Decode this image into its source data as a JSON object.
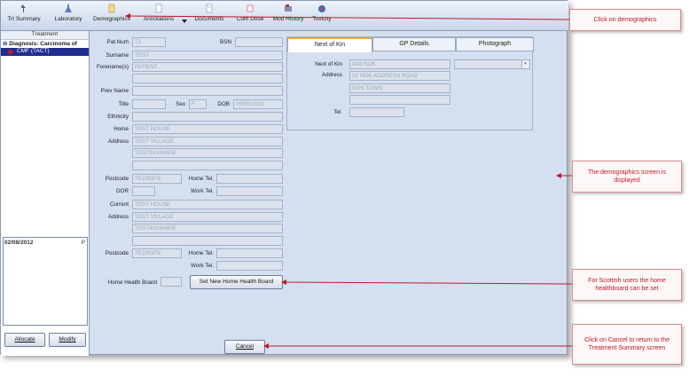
{
  "toolbar": {
    "items": [
      {
        "label": "Trt Summary",
        "icon": "treatment-summary-icon"
      },
      {
        "label": "Laboratory",
        "icon": "flask-icon"
      },
      {
        "label": "Demographics",
        "icon": "person-card-icon"
      },
      {
        "label": "Annotations",
        "icon": "note-icon"
      },
      {
        "label": "Documents",
        "icon": "document-icon"
      },
      {
        "label": "Cum Dose",
        "icon": "chart-icon"
      },
      {
        "label": "Mod History",
        "icon": "history-icon"
      },
      {
        "label": "Toxicity",
        "icon": "toxicity-icon"
      }
    ]
  },
  "left_panel": {
    "header": "Treatment",
    "diagnosis": "Diagnosis: Carcinoma of",
    "regimen": "CMF (TACT)",
    "date": "02/08/2012",
    "date_suffix": "P",
    "allocate_label": "Allocate",
    "modify_label": "Modify"
  },
  "form": {
    "patnum_label": "Pat.Num",
    "patnum": "T1",
    "bsn_label": "BSN",
    "surname_label": "Surname",
    "surname": "TEST",
    "forenames_label": "Forename(s)",
    "forenames": "PATIENT",
    "prevname_label": "Prev Name",
    "title_label": "Title",
    "sex_label": "Sex",
    "sex": "F",
    "dob_label": "DOB",
    "dob": "09/09/1933",
    "ethnicity_label": "Ethnicity",
    "home_label": "Home",
    "address_label": "Address",
    "home_addr1": "TEST HOUSE",
    "home_addr2": "TEST VILLAGE",
    "home_addr3": "TESTINGSHIRE",
    "postcode_label": "Postcode",
    "home_postcode": "TE238976",
    "home_tel_label": "Home Tel.",
    "dor_label": "DOR",
    "work_tel_label": "Work Tel.",
    "current_label": "Current",
    "cur_addr1": "TEST HOUSE",
    "cur_addr2": "TEST VILLAGE",
    "cur_addr3": "TESTINGSHIRE",
    "cur_postcode": "TE230976",
    "hhb_label": "Home Health Board",
    "set_hhb_label": "Set New Home Health Board",
    "cancel_label": "Cancel"
  },
  "kin": {
    "tabs": [
      "Next of Kin",
      "GP Details",
      "Photograph"
    ],
    "nok_label": "Next of Kin",
    "nok_name": "IAM NOK",
    "address_label": "Address",
    "addr1": "22 NOK ADDRESS ROAD",
    "addr2": "NOK TOWN",
    "tel_label": "Tel."
  },
  "callouts": {
    "demographics": "Click on demographics",
    "screen": "The demographics screen is displayed",
    "scottish": "For Scottish users the home healthboard can be set",
    "cancel": "Click on Cancel to return to the Treatment Summary screen"
  },
  "colors": {
    "callout_text": "#c0182b",
    "arrow": "#c0182b",
    "tab_accent": "#f0a830"
  }
}
